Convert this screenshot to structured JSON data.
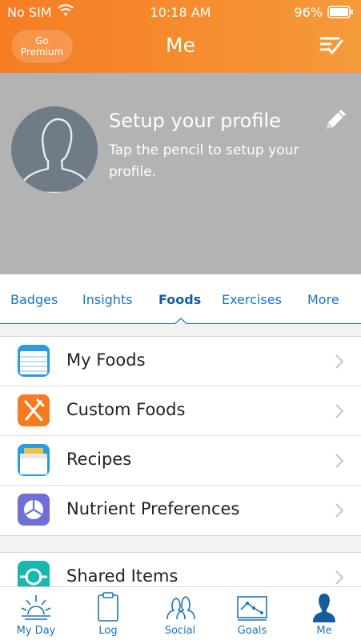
{
  "status": {
    "carrier": "No SIM",
    "time": "10:18 AM",
    "battery": "96%"
  },
  "header": {
    "premium_label": "Go\nPremium",
    "title": "Me"
  },
  "profile": {
    "title": "Setup your profile",
    "subtitle": "Tap the pencil to setup your profile."
  },
  "tabs": [
    {
      "label": "Badges"
    },
    {
      "label": "Insights"
    },
    {
      "label": "Foods",
      "active": true
    },
    {
      "label": "Exercises"
    },
    {
      "label": "More"
    }
  ],
  "food_items": [
    {
      "label": "My Foods",
      "icon": "notebook-icon"
    },
    {
      "label": "Custom Foods",
      "icon": "fork-knife-icon"
    },
    {
      "label": "Recipes",
      "icon": "recipe-box-icon"
    },
    {
      "label": "Nutrient Preferences",
      "icon": "pie-chart-icon"
    }
  ],
  "shared_items": [
    {
      "label": "Shared Items",
      "icon": "share-icon"
    }
  ],
  "tabbar": [
    {
      "label": "My Day",
      "icon": "sunrise-icon"
    },
    {
      "label": "Log",
      "icon": "clipboard-icon"
    },
    {
      "label": "Social",
      "icon": "people-icon"
    },
    {
      "label": "Goals",
      "icon": "graph-icon"
    },
    {
      "label": "Me",
      "icon": "person-icon"
    }
  ],
  "colors": {
    "accent": "#f67c22",
    "link": "#1a74b8",
    "profile_bg": "#b3b3b3"
  }
}
